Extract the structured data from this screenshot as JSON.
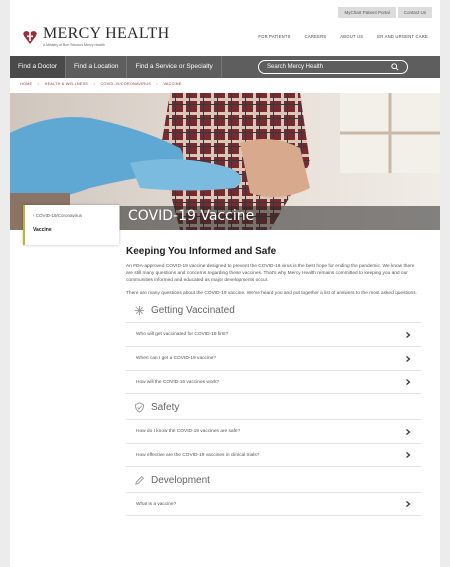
{
  "utility": {
    "portal": "MyChart Patient Portal",
    "contact": "Contact Us"
  },
  "logo": {
    "name": "MERCY HEALTH",
    "tagline": "A Ministry of Bon Secours Mercy Health"
  },
  "top_nav": [
    "FOR PATIENTS",
    "CAREERS",
    "ABOUT US",
    "ER AND URGENT CARE"
  ],
  "main_nav": {
    "items": [
      "Find a Doctor",
      "Find a Location",
      "Find a Service or Specialty"
    ],
    "search_placeholder": "Search Mercy Health"
  },
  "breadcrumb": [
    "HOME",
    "HEALTH & WELLNESS",
    "COVID-19/CORONAVIRUS",
    "VACCINE"
  ],
  "hero": {
    "title": "COVID-19 Vaccine"
  },
  "side_card": {
    "back": "COVID-19/Coronavirus",
    "current": "Vaccine"
  },
  "content": {
    "heading": "Keeping You Informed and Safe",
    "p1": "An FDA-approved COVID-19 vaccine designed to prevent the COVID-19 virus is the best hope for ending the pandemic. We know there are still many questions and concerns regarding these vaccines. That's why Mercy Health remains committed to keeping you and our communities informed and educated as major developments occur.",
    "p2": "There are many questions about the COVID-19 vaccine. We've heard you and put together a list of answers to the most asked questions."
  },
  "sections": [
    {
      "title": "Getting Vaccinated",
      "icon": "sparkle-icon",
      "questions": [
        "Who will get vaccinated for COVID-19 first?",
        "When can I get a COVID-19 vaccine?",
        "How will the COVID-19 vaccines work?"
      ]
    },
    {
      "title": "Safety",
      "icon": "shield-check-icon",
      "questions": [
        "How do I know the COVID-19 vaccines are safe?",
        "How effective are the COVID-19 vaccines in clinical trials?"
      ]
    },
    {
      "title": "Development",
      "icon": "pencil-icon",
      "questions": [
        "What is a vaccine?"
      ]
    }
  ],
  "colors": {
    "brand_red": "#9a2f3a",
    "nav_gray": "#5e5e5e",
    "accent_gold": "#c2b23a"
  }
}
